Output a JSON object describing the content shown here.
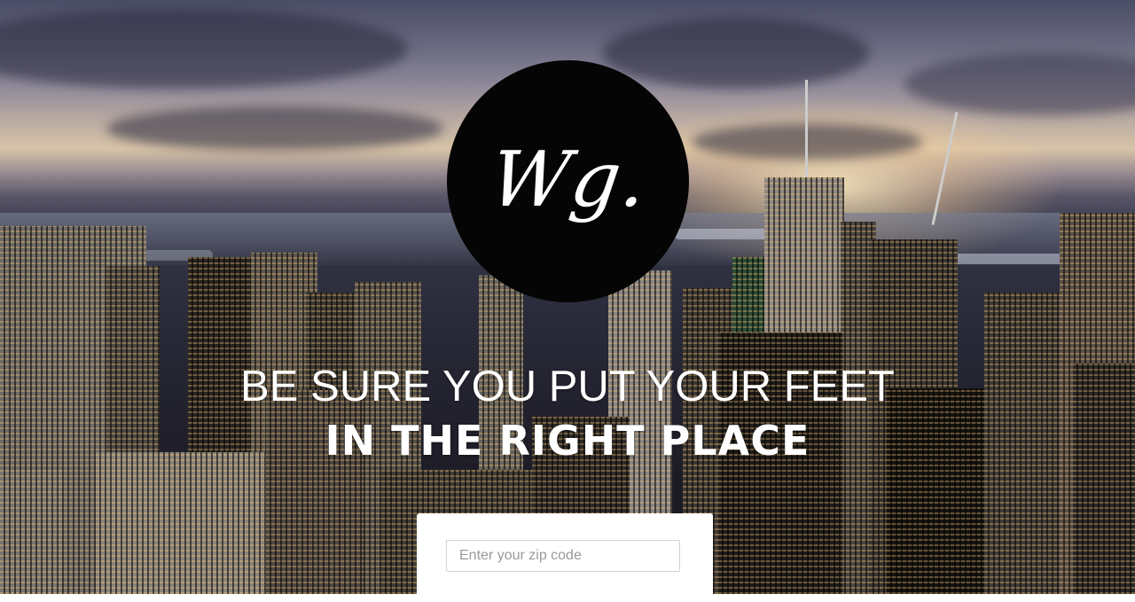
{
  "logo": {
    "text": "Wg."
  },
  "hero": {
    "headline_line1": "BE SURE YOU PUT YOUR FEET",
    "headline_line2": "IN THE RIGHT PLACE"
  },
  "search": {
    "zip_placeholder": "Enter your zip code",
    "zip_value": ""
  },
  "colors": {
    "logo_circle": "#050505",
    "text": "#ffffff",
    "card": "#ffffff"
  }
}
